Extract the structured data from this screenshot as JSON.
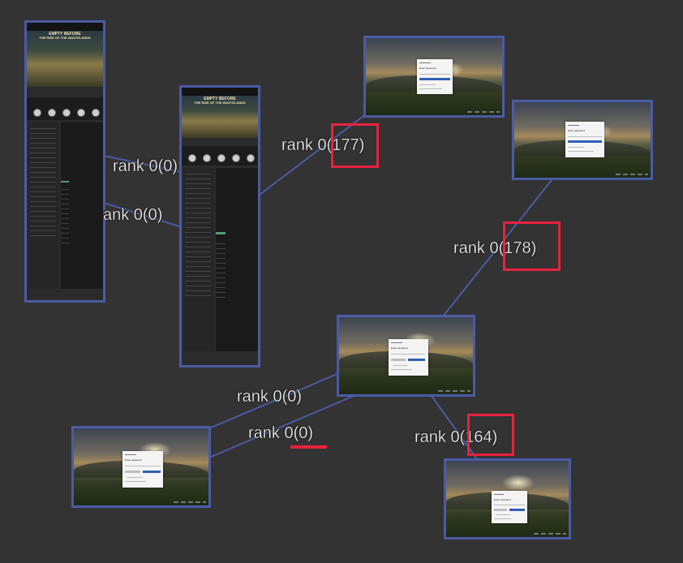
{
  "colors": {
    "background": "#333333",
    "node_border": "#4a5ba6",
    "edge": "#4a5ba6",
    "highlight": "#e8223d",
    "label": "#ffffff"
  },
  "nodes": [
    {
      "id": "tall-1",
      "kind": "webpage",
      "banner_line1": "EMPTY BEFORE",
      "banner_line2": "THE RISE OF THE WASTELANDS"
    },
    {
      "id": "tall-2",
      "kind": "webpage",
      "banner_line1": "EMPTY BEFORE",
      "banner_line2": "THE RISE OF THE WASTELANDS"
    },
    {
      "id": "login-1",
      "kind": "login",
      "dialog_title": "Enter password"
    },
    {
      "id": "login-2",
      "kind": "login",
      "dialog_title": "Enter password"
    },
    {
      "id": "login-3",
      "kind": "login",
      "dialog_title": "Enter password"
    },
    {
      "id": "login-4",
      "kind": "login",
      "dialog_title": "Enter password"
    },
    {
      "id": "login-5",
      "kind": "login",
      "dialog_title": "Enter password"
    }
  ],
  "edges": [
    {
      "from": "tall-1",
      "to": "tall-2",
      "label_prefix": "rank 0",
      "label_value": "(0)",
      "label_display": "rank 0(0)"
    },
    {
      "from": "tall-1",
      "to": "tall-2",
      "label_prefix": "ank 0",
      "label_value": "(0)",
      "label_display": "ank 0(0)"
    },
    {
      "from": "tall-2",
      "to": "login-1",
      "label_prefix": "rank 0",
      "label_value": "(177)",
      "label_display": "rank 0(177)"
    },
    {
      "from": "login-2",
      "to": "login-3",
      "label_prefix": "rank 0",
      "label_value": "(178)",
      "label_display": "rank 0(178)"
    },
    {
      "from": "login-3",
      "to": "login-4",
      "label_prefix": "rank 0",
      "label_value": "(0)",
      "label_display": "rank 0(0)"
    },
    {
      "from": "login-3",
      "to": "login-4",
      "label_prefix": "rank 0",
      "label_value": "(0)",
      "label_display": "rank 0(0)"
    },
    {
      "from": "login-3",
      "to": "login-5",
      "label_prefix": "rank 0",
      "label_value": "(164)",
      "label_display": "rank 0(164)"
    }
  ]
}
